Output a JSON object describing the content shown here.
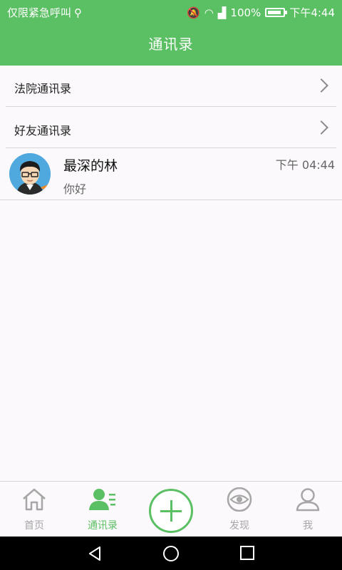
{
  "status_bar": {
    "left_text": "仅限紧急呼叫",
    "battery": "100%",
    "time": "下午4:44"
  },
  "header": {
    "title": "通讯录"
  },
  "contacts": [
    {
      "label": "法院通讯录"
    },
    {
      "label": "好友通讯录"
    }
  ],
  "chat": {
    "name": "最深的林",
    "message": "你好",
    "time": "下午 04:44"
  },
  "nav": {
    "items": [
      {
        "label": "首页",
        "icon": "home-icon",
        "active": false
      },
      {
        "label": "通讯录",
        "icon": "contacts-icon",
        "active": true
      },
      {
        "label": "",
        "icon": "add-icon",
        "active": false
      },
      {
        "label": "发现",
        "icon": "eye-icon",
        "active": false
      },
      {
        "label": "我",
        "icon": "person-icon",
        "active": false
      }
    ]
  },
  "colors": {
    "primary": "#5bbf63",
    "muted": "#a6a6a6"
  }
}
